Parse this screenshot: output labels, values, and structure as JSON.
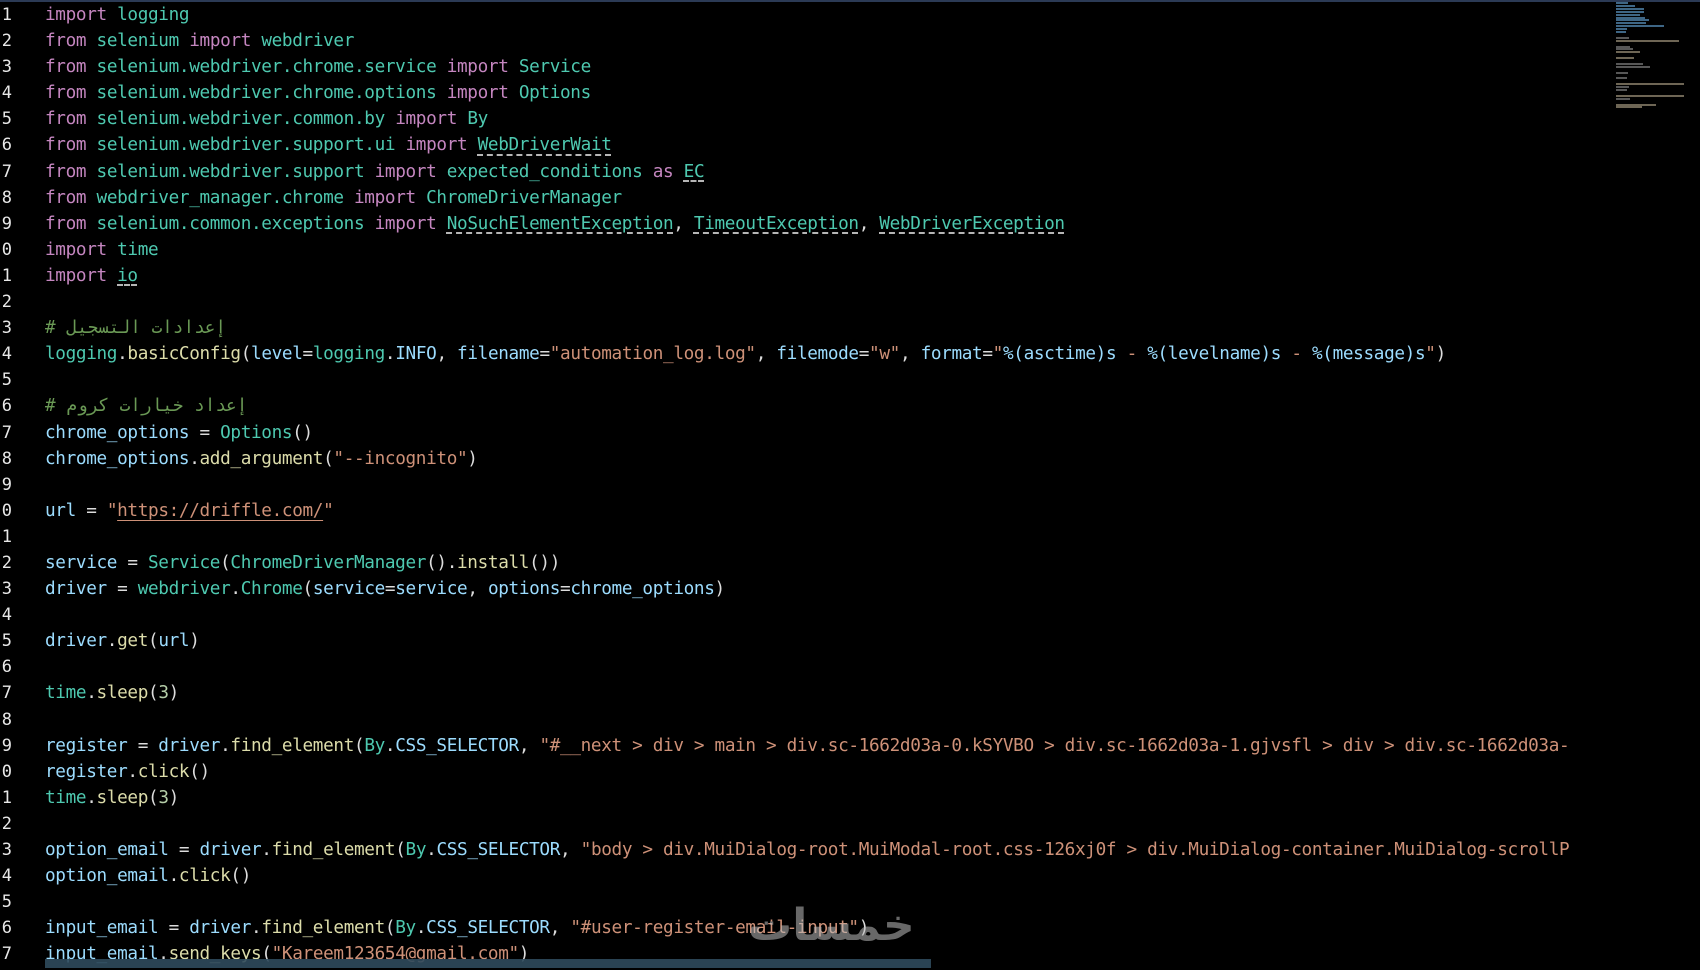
{
  "editor": {
    "lines": [
      {
        "number": "1",
        "segments": [
          {
            "t": "import",
            "c": "kw"
          },
          {
            "t": " "
          },
          {
            "t": "logging",
            "c": "mod"
          }
        ]
      },
      {
        "number": "2",
        "segments": [
          {
            "t": "from",
            "c": "kw"
          },
          {
            "t": " "
          },
          {
            "t": "selenium",
            "c": "mod"
          },
          {
            "t": " "
          },
          {
            "t": "import",
            "c": "kw"
          },
          {
            "t": " "
          },
          {
            "t": "webdriver",
            "c": "mod"
          }
        ]
      },
      {
        "number": "3",
        "segments": [
          {
            "t": "from",
            "c": "kw"
          },
          {
            "t": " "
          },
          {
            "t": "selenium.webdriver.chrome.service",
            "c": "mod"
          },
          {
            "t": " "
          },
          {
            "t": "import",
            "c": "kw"
          },
          {
            "t": " "
          },
          {
            "t": "Service",
            "c": "cls"
          }
        ]
      },
      {
        "number": "4",
        "segments": [
          {
            "t": "from",
            "c": "kw"
          },
          {
            "t": " "
          },
          {
            "t": "selenium.webdriver.chrome.options",
            "c": "mod"
          },
          {
            "t": " "
          },
          {
            "t": "import",
            "c": "kw"
          },
          {
            "t": " "
          },
          {
            "t": "Options",
            "c": "cls"
          }
        ]
      },
      {
        "number": "5",
        "segments": [
          {
            "t": "from",
            "c": "kw"
          },
          {
            "t": " "
          },
          {
            "t": "selenium.webdriver.common.by",
            "c": "mod"
          },
          {
            "t": " "
          },
          {
            "t": "import",
            "c": "kw"
          },
          {
            "t": " "
          },
          {
            "t": "By",
            "c": "cls"
          }
        ]
      },
      {
        "number": "6",
        "segments": [
          {
            "t": "from",
            "c": "kw"
          },
          {
            "t": " "
          },
          {
            "t": "selenium.webdriver.support.ui",
            "c": "mod"
          },
          {
            "t": " "
          },
          {
            "t": "import",
            "c": "kw"
          },
          {
            "t": " "
          },
          {
            "t": "WebDriverWait",
            "c": "cls sq"
          }
        ]
      },
      {
        "number": "7",
        "segments": [
          {
            "t": "from",
            "c": "kw"
          },
          {
            "t": " "
          },
          {
            "t": "selenium.webdriver.support",
            "c": "mod"
          },
          {
            "t": " "
          },
          {
            "t": "import",
            "c": "kw"
          },
          {
            "t": " "
          },
          {
            "t": "expected_conditions",
            "c": "mod"
          },
          {
            "t": " "
          },
          {
            "t": "as",
            "c": "kw"
          },
          {
            "t": " "
          },
          {
            "t": "EC",
            "c": "mod sq"
          }
        ]
      },
      {
        "number": "8",
        "segments": [
          {
            "t": "from",
            "c": "kw"
          },
          {
            "t": " "
          },
          {
            "t": "webdriver_manager.chrome",
            "c": "mod"
          },
          {
            "t": " "
          },
          {
            "t": "import",
            "c": "kw"
          },
          {
            "t": " "
          },
          {
            "t": "ChromeDriverManager",
            "c": "cls"
          }
        ]
      },
      {
        "number": "9",
        "segments": [
          {
            "t": "from",
            "c": "kw"
          },
          {
            "t": " "
          },
          {
            "t": "selenium.common.exceptions",
            "c": "mod"
          },
          {
            "t": " "
          },
          {
            "t": "import",
            "c": "kw"
          },
          {
            "t": " "
          },
          {
            "t": "NoSuchElementException",
            "c": "cls sq"
          },
          {
            "t": ", "
          },
          {
            "t": "TimeoutException",
            "c": "cls sq"
          },
          {
            "t": ", "
          },
          {
            "t": "WebDriverException",
            "c": "cls sq"
          }
        ]
      },
      {
        "number": "0",
        "segments": [
          {
            "t": "import",
            "c": "kw"
          },
          {
            "t": " "
          },
          {
            "t": "time",
            "c": "mod"
          }
        ]
      },
      {
        "number": "1",
        "segments": [
          {
            "t": "import",
            "c": "kw"
          },
          {
            "t": " "
          },
          {
            "t": "io",
            "c": "mod sq"
          }
        ]
      },
      {
        "number": "2",
        "segments": []
      },
      {
        "number": "3",
        "segments": [
          {
            "t": "# إعدادات التسجيل",
            "c": "cm"
          }
        ]
      },
      {
        "number": "4",
        "segments": [
          {
            "t": "logging",
            "c": "mod"
          },
          {
            "t": "."
          },
          {
            "t": "basicConfig",
            "c": "fn"
          },
          {
            "t": "("
          },
          {
            "t": "level",
            "c": "var"
          },
          {
            "t": "="
          },
          {
            "t": "logging",
            "c": "mod"
          },
          {
            "t": "."
          },
          {
            "t": "INFO",
            "c": "var"
          },
          {
            "t": ", "
          },
          {
            "t": "filename",
            "c": "var"
          },
          {
            "t": "="
          },
          {
            "t": "\"automation_log.log\"",
            "c": "str"
          },
          {
            "t": ", "
          },
          {
            "t": "filemode",
            "c": "var"
          },
          {
            "t": "="
          },
          {
            "t": "\"w\"",
            "c": "str"
          },
          {
            "t": ", "
          },
          {
            "t": "format",
            "c": "var"
          },
          {
            "t": "="
          },
          {
            "t": "\"",
            "c": "str"
          },
          {
            "t": "%(asctime)s",
            "c": "var"
          },
          {
            "t": " - ",
            "c": "str"
          },
          {
            "t": "%(levelname)s",
            "c": "var"
          },
          {
            "t": " - ",
            "c": "str"
          },
          {
            "t": "%(message)s",
            "c": "var"
          },
          {
            "t": "\"",
            "c": "str"
          },
          {
            "t": ")"
          }
        ]
      },
      {
        "number": "5",
        "segments": []
      },
      {
        "number": "6",
        "segments": [
          {
            "t": "# إعداد خيارات كروم",
            "c": "cm"
          }
        ]
      },
      {
        "number": "7",
        "segments": [
          {
            "t": "chrome_options",
            "c": "var"
          },
          {
            "t": " = "
          },
          {
            "t": "Options",
            "c": "cls"
          },
          {
            "t": "()"
          }
        ]
      },
      {
        "number": "8",
        "segments": [
          {
            "t": "chrome_options",
            "c": "var"
          },
          {
            "t": "."
          },
          {
            "t": "add_argument",
            "c": "fn"
          },
          {
            "t": "("
          },
          {
            "t": "\"--incognito\"",
            "c": "str"
          },
          {
            "t": ")"
          }
        ]
      },
      {
        "number": "9",
        "segments": []
      },
      {
        "number": "0",
        "segments": [
          {
            "t": "url",
            "c": "var"
          },
          {
            "t": " = "
          },
          {
            "t": "\"",
            "c": "str"
          },
          {
            "t": "https://driffle.com/",
            "c": "str url"
          },
          {
            "t": "\"",
            "c": "str"
          }
        ]
      },
      {
        "number": "1",
        "segments": []
      },
      {
        "number": "2",
        "segments": [
          {
            "t": "service",
            "c": "var"
          },
          {
            "t": " = "
          },
          {
            "t": "Service",
            "c": "cls"
          },
          {
            "t": "("
          },
          {
            "t": "ChromeDriverManager",
            "c": "cls"
          },
          {
            "t": "()."
          },
          {
            "t": "install",
            "c": "fn"
          },
          {
            "t": "())"
          }
        ]
      },
      {
        "number": "3",
        "segments": [
          {
            "t": "driver",
            "c": "var"
          },
          {
            "t": " = "
          },
          {
            "t": "webdriver",
            "c": "mod"
          },
          {
            "t": "."
          },
          {
            "t": "Chrome",
            "c": "cls"
          },
          {
            "t": "("
          },
          {
            "t": "service",
            "c": "var"
          },
          {
            "t": "="
          },
          {
            "t": "service",
            "c": "var"
          },
          {
            "t": ", "
          },
          {
            "t": "options",
            "c": "var"
          },
          {
            "t": "="
          },
          {
            "t": "chrome_options",
            "c": "var"
          },
          {
            "t": ")"
          }
        ]
      },
      {
        "number": "4",
        "segments": []
      },
      {
        "number": "5",
        "segments": [
          {
            "t": "driver",
            "c": "var"
          },
          {
            "t": "."
          },
          {
            "t": "get",
            "c": "fn"
          },
          {
            "t": "("
          },
          {
            "t": "url",
            "c": "var"
          },
          {
            "t": ")"
          }
        ]
      },
      {
        "number": "6",
        "segments": []
      },
      {
        "number": "7",
        "segments": [
          {
            "t": "time",
            "c": "mod"
          },
          {
            "t": "."
          },
          {
            "t": "sleep",
            "c": "fn"
          },
          {
            "t": "("
          },
          {
            "t": "3",
            "c": "num"
          },
          {
            "t": ")"
          }
        ]
      },
      {
        "number": "8",
        "segments": []
      },
      {
        "number": "9",
        "segments": [
          {
            "t": "register",
            "c": "var"
          },
          {
            "t": " = "
          },
          {
            "t": "driver",
            "c": "var"
          },
          {
            "t": "."
          },
          {
            "t": "find_element",
            "c": "fn"
          },
          {
            "t": "("
          },
          {
            "t": "By",
            "c": "cls"
          },
          {
            "t": "."
          },
          {
            "t": "CSS_SELECTOR",
            "c": "var"
          },
          {
            "t": ", "
          },
          {
            "t": "\"#__next > div > main > div.sc-1662d03a-0.kSYVBO > div.sc-1662d03a-1.gjvsfl > div > div.sc-1662d03a-",
            "c": "str"
          }
        ]
      },
      {
        "number": "0",
        "segments": [
          {
            "t": "register",
            "c": "var"
          },
          {
            "t": "."
          },
          {
            "t": "click",
            "c": "fn"
          },
          {
            "t": "()"
          }
        ]
      },
      {
        "number": "1",
        "segments": [
          {
            "t": "time",
            "c": "mod"
          },
          {
            "t": "."
          },
          {
            "t": "sleep",
            "c": "fn"
          },
          {
            "t": "("
          },
          {
            "t": "3",
            "c": "num"
          },
          {
            "t": ")"
          }
        ]
      },
      {
        "number": "2",
        "segments": []
      },
      {
        "number": "3",
        "segments": [
          {
            "t": "option_email",
            "c": "var"
          },
          {
            "t": " = "
          },
          {
            "t": "driver",
            "c": "var"
          },
          {
            "t": "."
          },
          {
            "t": "find_element",
            "c": "fn"
          },
          {
            "t": "("
          },
          {
            "t": "By",
            "c": "cls"
          },
          {
            "t": "."
          },
          {
            "t": "CSS_SELECTOR",
            "c": "var"
          },
          {
            "t": ", "
          },
          {
            "t": "\"body > div.MuiDialog-root.MuiModal-root.css-126xj0f > div.MuiDialog-container.MuiDialog-scrollP",
            "c": "str"
          }
        ]
      },
      {
        "number": "4",
        "segments": [
          {
            "t": "option_email",
            "c": "var"
          },
          {
            "t": "."
          },
          {
            "t": "click",
            "c": "fn"
          },
          {
            "t": "()"
          }
        ]
      },
      {
        "number": "5",
        "segments": []
      },
      {
        "number": "6",
        "segments": [
          {
            "t": "input_email",
            "c": "var"
          },
          {
            "t": " = "
          },
          {
            "t": "driver",
            "c": "var"
          },
          {
            "t": "."
          },
          {
            "t": "find_element",
            "c": "fn"
          },
          {
            "t": "("
          },
          {
            "t": "By",
            "c": "cls"
          },
          {
            "t": "."
          },
          {
            "t": "CSS_SELECTOR",
            "c": "var"
          },
          {
            "t": ", "
          },
          {
            "t": "\"#user-register-email-input\"",
            "c": "str"
          },
          {
            "t": ")"
          }
        ]
      },
      {
        "number": "7",
        "segments": [
          {
            "t": "input_email",
            "c": "var"
          },
          {
            "t": "."
          },
          {
            "t": "send_keys",
            "c": "fn"
          },
          {
            "t": "("
          },
          {
            "t": "\"Kareem123654@gmail.com\"",
            "c": "str"
          },
          {
            "t": ")"
          }
        ]
      }
    ]
  },
  "watermark": "خمسات",
  "colors": {
    "background": "#000000",
    "keyword": "#c586c0",
    "module": "#4ec9b0",
    "function": "#dcdcaa",
    "variable": "#9cdcfe",
    "string": "#ce9178",
    "number": "#b5cea8",
    "comment": "#6a9955"
  }
}
